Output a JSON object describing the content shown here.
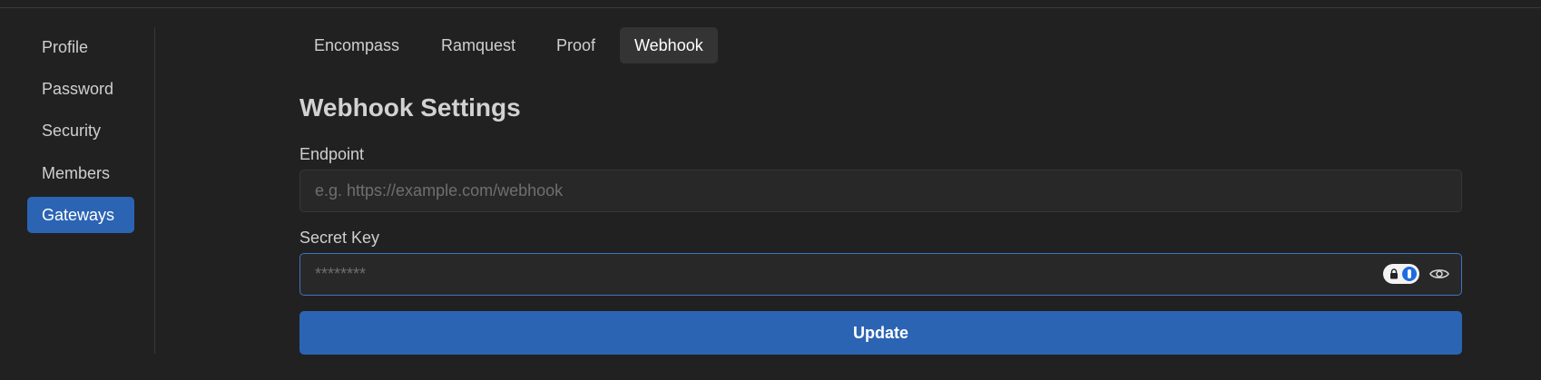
{
  "sidebar": {
    "items": [
      {
        "label": "Profile"
      },
      {
        "label": "Password"
      },
      {
        "label": "Security"
      },
      {
        "label": "Members"
      },
      {
        "label": "Gateways"
      }
    ]
  },
  "tabs": [
    {
      "label": "Encompass"
    },
    {
      "label": "Ramquest"
    },
    {
      "label": "Proof"
    },
    {
      "label": "Webhook"
    }
  ],
  "form": {
    "title": "Webhook Settings",
    "endpoint": {
      "label": "Endpoint",
      "value": "",
      "placeholder": "e.g. https://example.com/webhook"
    },
    "secret": {
      "label": "Secret Key",
      "value": "",
      "placeholder": "********"
    },
    "submit_label": "Update"
  },
  "icons": {
    "password_manager": "password-manager-icon",
    "visibility": "eye-icon"
  },
  "colors": {
    "background": "#212121",
    "accent": "#2c64b4",
    "active_tab_bg": "#343434"
  }
}
